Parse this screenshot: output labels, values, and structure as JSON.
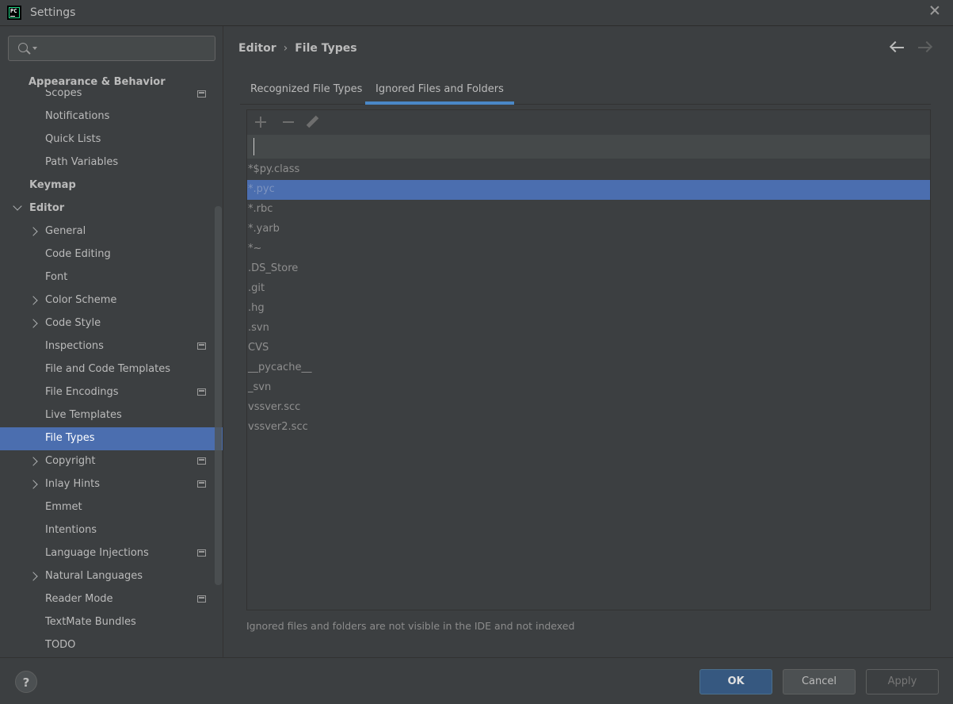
{
  "window": {
    "title": "Settings"
  },
  "search": {
    "value": "",
    "placeholder": ""
  },
  "sidebar": {
    "group_header": "Appearance & Behavior",
    "items": [
      {
        "label": "Scopes",
        "top": 0
      },
      {
        "label": "Notifications"
      },
      {
        "label": "Quick Lists"
      },
      {
        "label": "Path Variables"
      },
      {
        "label": "Keymap"
      },
      {
        "label": "Editor"
      },
      {
        "label": "General"
      },
      {
        "label": "Code Editing"
      },
      {
        "label": "Font"
      },
      {
        "label": "Color Scheme"
      },
      {
        "label": "Code Style"
      },
      {
        "label": "Inspections"
      },
      {
        "label": "File and Code Templates"
      },
      {
        "label": "File Encodings"
      },
      {
        "label": "Live Templates"
      },
      {
        "label": "File Types"
      },
      {
        "label": "Copyright"
      },
      {
        "label": "Inlay Hints"
      },
      {
        "label": "Emmet"
      },
      {
        "label": "Intentions"
      },
      {
        "label": "Language Injections"
      },
      {
        "label": "Natural Languages"
      },
      {
        "label": "Reader Mode"
      },
      {
        "label": "TextMate Bundles"
      },
      {
        "label": "TODO"
      }
    ]
  },
  "breadcrumb": {
    "parent": "Editor",
    "separator": "›",
    "current": "File Types"
  },
  "tabs": [
    "Recognized File Types",
    "Ignored Files and Folders"
  ],
  "edit_row": {
    "value": ""
  },
  "files": [
    "*$py.class",
    "*.pyc",
    "*.rbc",
    "*.yarb",
    "*~",
    ".DS_Store",
    ".git",
    ".hg",
    ".svn",
    "CVS",
    "__pycache__",
    "_svn",
    "vssver.scc",
    "vssver2.scc"
  ],
  "hint": "Ignored files and folders are not visible in the IDE and not indexed",
  "footer": {
    "help": "?",
    "ok": "OK",
    "cancel": "Cancel",
    "apply": "Apply"
  },
  "colors": {
    "accent": "#4b6eaf",
    "tab_underline": "#4a88c7",
    "background": "#3c3f41"
  }
}
